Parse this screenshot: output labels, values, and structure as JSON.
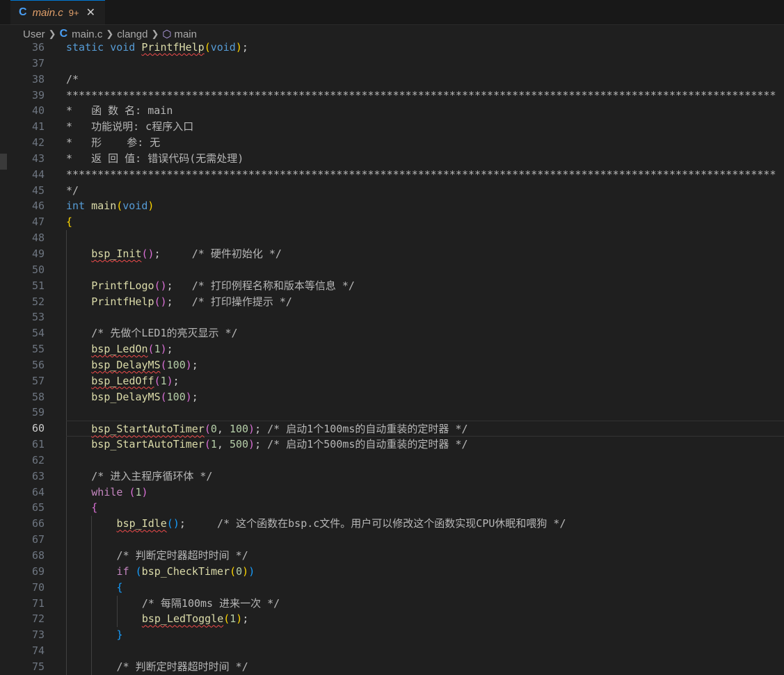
{
  "tab": {
    "lang_icon": "C",
    "title": "main.c",
    "badge": "9+",
    "close": "✕"
  },
  "breadcrumb": {
    "items": [
      "User",
      "main.c",
      "clangd",
      "main"
    ],
    "c_icon": "C",
    "symbol_icon": "⬡"
  },
  "colors": {
    "background": "#1f1f1f",
    "keyword": "#569cd6",
    "control": "#c586c0",
    "function": "#dcdcaa",
    "number": "#b5cea8",
    "comment": "#b7b7b7",
    "error_squiggle": "#f14c4c",
    "tab_title": "#e2a06b"
  },
  "current_line": 60,
  "lines": [
    {
      "n": "36",
      "indent": 0,
      "tokens": [
        [
          "kw",
          "static "
        ],
        [
          "kw",
          "void "
        ],
        [
          "fn sq",
          "PrintfHelp"
        ],
        [
          "p1",
          "("
        ],
        [
          "kw",
          "void"
        ],
        [
          "p1",
          ")"
        ],
        [
          "",
          "; "
        ]
      ]
    },
    {
      "n": "37",
      "indent": 0,
      "tokens": []
    },
    {
      "n": "38",
      "indent": 0,
      "tokens": [
        [
          "cm",
          "/*"
        ]
      ]
    },
    {
      "n": "39",
      "indent": 0,
      "tokens": [
        [
          "cm",
          "*****************************************************************************************************************"
        ]
      ]
    },
    {
      "n": "40",
      "indent": 0,
      "tokens": [
        [
          "cm",
          "*   函 数 名: main"
        ]
      ]
    },
    {
      "n": "41",
      "indent": 0,
      "tokens": [
        [
          "cm",
          "*   功能说明: c程序入口"
        ]
      ]
    },
    {
      "n": "42",
      "indent": 0,
      "tokens": [
        [
          "cm",
          "*   形    参: 无"
        ]
      ]
    },
    {
      "n": "43",
      "indent": 0,
      "tokens": [
        [
          "cm",
          "*   返 回 值: 错误代码(无需处理)"
        ]
      ]
    },
    {
      "n": "44",
      "indent": 0,
      "tokens": [
        [
          "cm",
          "*****************************************************************************************************************"
        ]
      ]
    },
    {
      "n": "45",
      "indent": 0,
      "tokens": [
        [
          "cm",
          "*/"
        ]
      ]
    },
    {
      "n": "46",
      "indent": 0,
      "tokens": [
        [
          "kw",
          "int "
        ],
        [
          "fn",
          "main"
        ],
        [
          "p1",
          "("
        ],
        [
          "kw",
          "void"
        ],
        [
          "p1",
          ")"
        ]
      ]
    },
    {
      "n": "47",
      "indent": 0,
      "tokens": [
        [
          "p1",
          "{"
        ]
      ]
    },
    {
      "n": "48",
      "indent": 1,
      "tokens": []
    },
    {
      "n": "49",
      "indent": 1,
      "tokens": [
        [
          "fn sq",
          "bsp_Init"
        ],
        [
          "p2",
          "()"
        ],
        [
          "",
          ";     "
        ],
        [
          "cm",
          "/* 硬件初始化 */"
        ]
      ]
    },
    {
      "n": "50",
      "indent": 1,
      "tokens": []
    },
    {
      "n": "51",
      "indent": 1,
      "tokens": [
        [
          "fn",
          "PrintfLogo"
        ],
        [
          "p2",
          "()"
        ],
        [
          "",
          ";   "
        ],
        [
          "cm",
          "/* 打印例程名称和版本等信息 */"
        ]
      ]
    },
    {
      "n": "52",
      "indent": 1,
      "tokens": [
        [
          "fn",
          "PrintfHelp"
        ],
        [
          "p2",
          "()"
        ],
        [
          "",
          ";   "
        ],
        [
          "cm",
          "/* 打印操作提示 */"
        ]
      ]
    },
    {
      "n": "53",
      "indent": 1,
      "tokens": []
    },
    {
      "n": "54",
      "indent": 1,
      "tokens": [
        [
          "cm",
          "/* 先做个LED1的亮灭显示 */"
        ]
      ]
    },
    {
      "n": "55",
      "indent": 1,
      "tokens": [
        [
          "fn sq",
          "bsp_LedOn"
        ],
        [
          "p2",
          "("
        ],
        [
          "num",
          "1"
        ],
        [
          "p2",
          ")"
        ],
        [
          "",
          ";"
        ]
      ]
    },
    {
      "n": "56",
      "indent": 1,
      "tokens": [
        [
          "fn sq",
          "bsp_DelayMS"
        ],
        [
          "p2",
          "("
        ],
        [
          "num",
          "100"
        ],
        [
          "p2",
          ")"
        ],
        [
          "",
          ";"
        ]
      ]
    },
    {
      "n": "57",
      "indent": 1,
      "tokens": [
        [
          "fn sq",
          "bsp_LedOff"
        ],
        [
          "p2",
          "("
        ],
        [
          "num",
          "1"
        ],
        [
          "p2",
          ")"
        ],
        [
          "",
          ";"
        ]
      ]
    },
    {
      "n": "58",
      "indent": 1,
      "tokens": [
        [
          "fn",
          "bsp_DelayMS"
        ],
        [
          "p2",
          "("
        ],
        [
          "num",
          "100"
        ],
        [
          "p2",
          ")"
        ],
        [
          "",
          ";"
        ]
      ]
    },
    {
      "n": "59",
      "indent": 1,
      "tokens": []
    },
    {
      "n": "60",
      "indent": 1,
      "tokens": [
        [
          "fn sq",
          "bsp_StartAutoTimer"
        ],
        [
          "p2",
          "("
        ],
        [
          "num",
          "0"
        ],
        [
          "",
          ", "
        ],
        [
          "num",
          "100"
        ],
        [
          "p2",
          ")"
        ],
        [
          "",
          "; "
        ],
        [
          "cm",
          "/* 启动1个100ms的自动重装的定时器 */"
        ]
      ]
    },
    {
      "n": "61",
      "indent": 1,
      "tokens": [
        [
          "fn",
          "bsp_StartAutoTimer"
        ],
        [
          "p2",
          "("
        ],
        [
          "num",
          "1"
        ],
        [
          "",
          ", "
        ],
        [
          "num",
          "500"
        ],
        [
          "p2",
          ")"
        ],
        [
          "",
          "; "
        ],
        [
          "cm",
          "/* 启动1个500ms的自动重装的定时器 */"
        ]
      ]
    },
    {
      "n": "62",
      "indent": 1,
      "tokens": []
    },
    {
      "n": "63",
      "indent": 1,
      "tokens": [
        [
          "cm",
          "/* 进入主程序循环体 */"
        ]
      ]
    },
    {
      "n": "64",
      "indent": 1,
      "tokens": [
        [
          "ctl",
          "while "
        ],
        [
          "p2",
          "("
        ],
        [
          "num",
          "1"
        ],
        [
          "p2",
          ")"
        ]
      ]
    },
    {
      "n": "65",
      "indent": 1,
      "tokens": [
        [
          "p2",
          "{"
        ]
      ]
    },
    {
      "n": "66",
      "indent": 2,
      "tokens": [
        [
          "fn sq",
          "bsp_Idle"
        ],
        [
          "p3",
          "()"
        ],
        [
          "",
          ";     "
        ],
        [
          "cm",
          "/* 这个函数在bsp.c文件。用户可以修改这个函数实现CPU休眠和喂狗 */"
        ]
      ]
    },
    {
      "n": "67",
      "indent": 2,
      "tokens": []
    },
    {
      "n": "68",
      "indent": 2,
      "tokens": [
        [
          "cm",
          "/* 判断定时器超时时间 */"
        ]
      ]
    },
    {
      "n": "69",
      "indent": 2,
      "tokens": [
        [
          "ctl",
          "if "
        ],
        [
          "p3",
          "("
        ],
        [
          "fn",
          "bsp_CheckTimer"
        ],
        [
          "p1",
          "("
        ],
        [
          "num",
          "0"
        ],
        [
          "p1",
          ")"
        ],
        [
          "p3",
          ")"
        ]
      ]
    },
    {
      "n": "70",
      "indent": 2,
      "tokens": [
        [
          "p3",
          "{"
        ]
      ]
    },
    {
      "n": "71",
      "indent": 3,
      "tokens": [
        [
          "cm",
          "/* 每隔100ms 进来一次 */"
        ]
      ]
    },
    {
      "n": "72",
      "indent": 3,
      "tokens": [
        [
          "fn sq",
          "bsp_LedToggle"
        ],
        [
          "p1",
          "("
        ],
        [
          "num",
          "1"
        ],
        [
          "p1",
          ")"
        ],
        [
          "",
          ";"
        ]
      ]
    },
    {
      "n": "73",
      "indent": 2,
      "tokens": [
        [
          "p3",
          "}"
        ]
      ]
    },
    {
      "n": "74",
      "indent": 2,
      "tokens": []
    },
    {
      "n": "75",
      "indent": 2,
      "tokens": [
        [
          "cm",
          "/* 判断定时器超时时间 */"
        ]
      ]
    }
  ]
}
